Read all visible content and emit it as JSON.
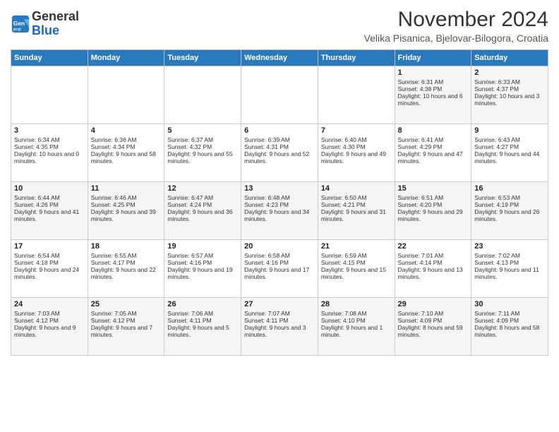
{
  "header": {
    "logo_line1": "General",
    "logo_line2": "Blue",
    "main_title": "November 2024",
    "subtitle": "Velika Pisanica, Bjelovar-Bilogora, Croatia"
  },
  "columns": [
    "Sunday",
    "Monday",
    "Tuesday",
    "Wednesday",
    "Thursday",
    "Friday",
    "Saturday"
  ],
  "weeks": [
    {
      "cells": [
        {
          "day": "",
          "info": ""
        },
        {
          "day": "",
          "info": ""
        },
        {
          "day": "",
          "info": ""
        },
        {
          "day": "",
          "info": ""
        },
        {
          "day": "",
          "info": ""
        },
        {
          "day": "1",
          "info": "Sunrise: 6:31 AM\nSunset: 4:38 PM\nDaylight: 10 hours and 6 minutes."
        },
        {
          "day": "2",
          "info": "Sunrise: 6:33 AM\nSunset: 4:37 PM\nDaylight: 10 hours and 3 minutes."
        }
      ]
    },
    {
      "cells": [
        {
          "day": "3",
          "info": "Sunrise: 6:34 AM\nSunset: 4:35 PM\nDaylight: 10 hours and 0 minutes."
        },
        {
          "day": "4",
          "info": "Sunrise: 6:36 AM\nSunset: 4:34 PM\nDaylight: 9 hours and 58 minutes."
        },
        {
          "day": "5",
          "info": "Sunrise: 6:37 AM\nSunset: 4:32 PM\nDaylight: 9 hours and 55 minutes."
        },
        {
          "day": "6",
          "info": "Sunrise: 6:39 AM\nSunset: 4:31 PM\nDaylight: 9 hours and 52 minutes."
        },
        {
          "day": "7",
          "info": "Sunrise: 6:40 AM\nSunset: 4:30 PM\nDaylight: 9 hours and 49 minutes."
        },
        {
          "day": "8",
          "info": "Sunrise: 6:41 AM\nSunset: 4:29 PM\nDaylight: 9 hours and 47 minutes."
        },
        {
          "day": "9",
          "info": "Sunrise: 6:43 AM\nSunset: 4:27 PM\nDaylight: 9 hours and 44 minutes."
        }
      ]
    },
    {
      "cells": [
        {
          "day": "10",
          "info": "Sunrise: 6:44 AM\nSunset: 4:26 PM\nDaylight: 9 hours and 41 minutes."
        },
        {
          "day": "11",
          "info": "Sunrise: 6:46 AM\nSunset: 4:25 PM\nDaylight: 9 hours and 39 minutes."
        },
        {
          "day": "12",
          "info": "Sunrise: 6:47 AM\nSunset: 4:24 PM\nDaylight: 9 hours and 36 minutes."
        },
        {
          "day": "13",
          "info": "Sunrise: 6:48 AM\nSunset: 4:23 PM\nDaylight: 9 hours and 34 minutes."
        },
        {
          "day": "14",
          "info": "Sunrise: 6:50 AM\nSunset: 4:21 PM\nDaylight: 9 hours and 31 minutes."
        },
        {
          "day": "15",
          "info": "Sunrise: 6:51 AM\nSunset: 4:20 PM\nDaylight: 9 hours and 29 minutes."
        },
        {
          "day": "16",
          "info": "Sunrise: 6:53 AM\nSunset: 4:19 PM\nDaylight: 9 hours and 26 minutes."
        }
      ]
    },
    {
      "cells": [
        {
          "day": "17",
          "info": "Sunrise: 6:54 AM\nSunset: 4:18 PM\nDaylight: 9 hours and 24 minutes."
        },
        {
          "day": "18",
          "info": "Sunrise: 6:55 AM\nSunset: 4:17 PM\nDaylight: 9 hours and 22 minutes."
        },
        {
          "day": "19",
          "info": "Sunrise: 6:57 AM\nSunset: 4:16 PM\nDaylight: 9 hours and 19 minutes."
        },
        {
          "day": "20",
          "info": "Sunrise: 6:58 AM\nSunset: 4:16 PM\nDaylight: 9 hours and 17 minutes."
        },
        {
          "day": "21",
          "info": "Sunrise: 6:59 AM\nSunset: 4:15 PM\nDaylight: 9 hours and 15 minutes."
        },
        {
          "day": "22",
          "info": "Sunrise: 7:01 AM\nSunset: 4:14 PM\nDaylight: 9 hours and 13 minutes."
        },
        {
          "day": "23",
          "info": "Sunrise: 7:02 AM\nSunset: 4:13 PM\nDaylight: 9 hours and 11 minutes."
        }
      ]
    },
    {
      "cells": [
        {
          "day": "24",
          "info": "Sunrise: 7:03 AM\nSunset: 4:12 PM\nDaylight: 9 hours and 9 minutes."
        },
        {
          "day": "25",
          "info": "Sunrise: 7:05 AM\nSunset: 4:12 PM\nDaylight: 9 hours and 7 minutes."
        },
        {
          "day": "26",
          "info": "Sunrise: 7:06 AM\nSunset: 4:11 PM\nDaylight: 9 hours and 5 minutes."
        },
        {
          "day": "27",
          "info": "Sunrise: 7:07 AM\nSunset: 4:11 PM\nDaylight: 9 hours and 3 minutes."
        },
        {
          "day": "28",
          "info": "Sunrise: 7:08 AM\nSunset: 4:10 PM\nDaylight: 9 hours and 1 minute."
        },
        {
          "day": "29",
          "info": "Sunrise: 7:10 AM\nSunset: 4:09 PM\nDaylight: 8 hours and 59 minutes."
        },
        {
          "day": "30",
          "info": "Sunrise: 7:11 AM\nSunset: 4:09 PM\nDaylight: 8 hours and 58 minutes."
        }
      ]
    }
  ]
}
